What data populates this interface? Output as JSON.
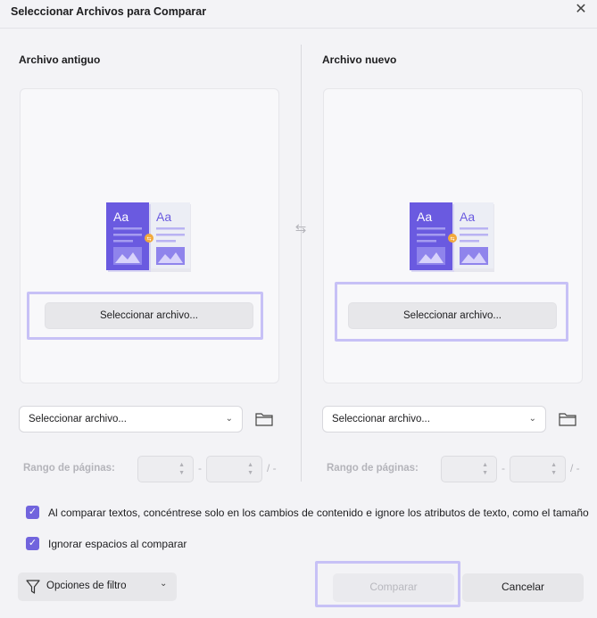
{
  "dialog": {
    "title": "Seleccionar Archivos para Comparar",
    "close_icon": "close-icon",
    "swap_icon": "swap-arrows-icon"
  },
  "old_file": {
    "heading": "Archivo antiguo",
    "select_button": "Seleccionar archivo...",
    "dropdown_value": "Seleccionar archivo...",
    "folder_icon": "folder-icon",
    "page_range_label": "Rango de páginas:",
    "range_separator": "-",
    "range_end": "/ -"
  },
  "new_file": {
    "heading": "Archivo nuevo",
    "select_button": "Seleccionar archivo...",
    "dropdown_value": "Seleccionar archivo...",
    "folder_icon": "folder-icon",
    "page_range_label": "Rango de páginas:",
    "range_separator": "-",
    "range_end": "/ -"
  },
  "options": {
    "compare_content_only": {
      "checked": true,
      "label": "Al comparar textos, concéntrese solo en los cambios de contenido e ignore los atributos de texto, como el tamaño"
    },
    "ignore_spaces": {
      "checked": true,
      "label": "Ignorar espacios al comparar"
    }
  },
  "footer": {
    "filter_label": "Opciones de filtro",
    "compare_label": "Comparar",
    "cancel_label": "Cancelar"
  },
  "illustration": {
    "left_page_text": "Aa",
    "right_page_text": "Aa"
  },
  "colors": {
    "accent": "#7164dd",
    "highlight": "#c7c1f6",
    "doc_primary": "#6a5ae0"
  }
}
